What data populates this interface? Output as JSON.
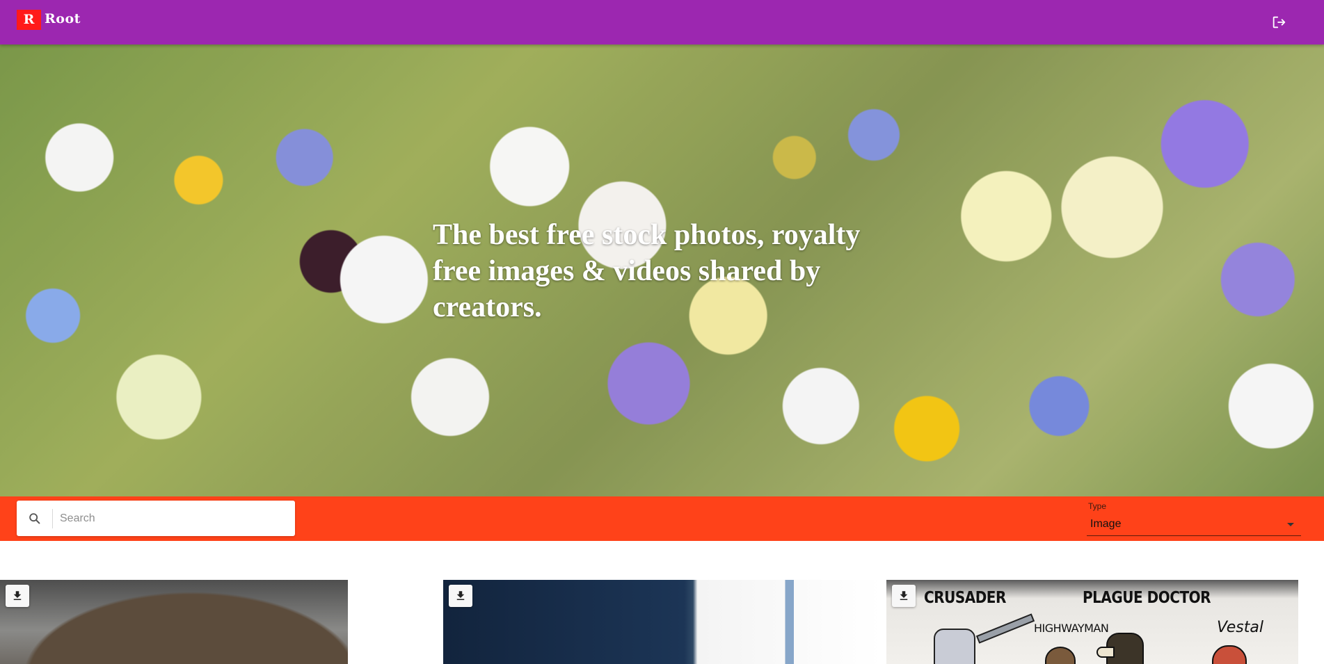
{
  "app": {
    "logo_letter": "R",
    "name": "Root",
    "logout_icon": "logout-icon",
    "bar_color": "#9c27b0"
  },
  "hero": {
    "title": "The best free stock photos, royalty free images & videos shared by creators."
  },
  "toolbar": {
    "color": "#ff4219",
    "search": {
      "placeholder": "Search",
      "value": ""
    },
    "type": {
      "label": "Type",
      "value": "Image"
    }
  },
  "results": [
    {
      "download_icon": "download-icon",
      "art_text": []
    },
    {
      "download_icon": "download-icon",
      "art_text": []
    },
    {
      "download_icon": "download-icon",
      "art_text": [
        "CRUSADER",
        "PLAGUE DOCTOR",
        "HIGHWAYMAN",
        "Vestal"
      ]
    }
  ]
}
